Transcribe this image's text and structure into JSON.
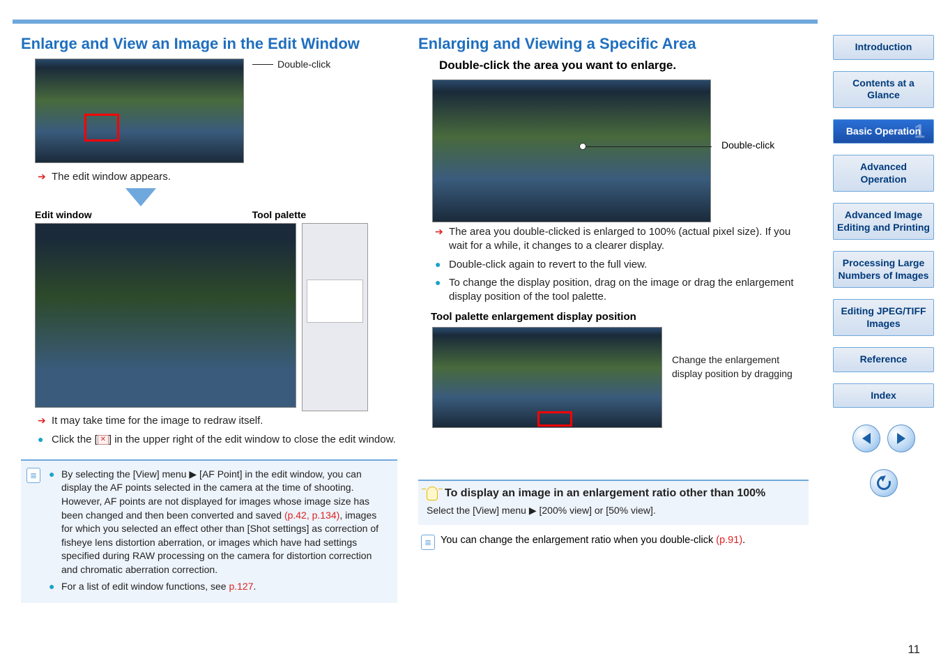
{
  "left": {
    "heading": "Enlarge and View an Image in the Edit Window",
    "doubleClick": "Double-click",
    "editAppears": "The edit window appears.",
    "editWindowLabel": "Edit window",
    "toolPaletteLabel": "Tool palette",
    "redrawNote": "It may take time for the image to redraw itself.",
    "closeNote_a": "Click the [",
    "closeNote_b": "] in the upper right of the edit window to close the edit window.",
    "info": {
      "p1_a": "By selecting the [View] menu ▶ [AF Point] in the edit window, you can display the AF points selected in the camera at the time of shooting. However, AF points are not displayed for images whose image size has been changed and then been converted and saved ",
      "p1_link": "(p.42, p.134)",
      "p1_b": ", images for which you selected an effect other than [Shot settings] as correction of fisheye lens distortion aberration, or images which have had settings specified during RAW processing on the camera for distortion correction and chromatic aberration correction.",
      "p2_a": "For a list of edit window functions, see ",
      "p2_link": "p.127",
      "p2_b": "."
    }
  },
  "right": {
    "heading": "Enlarging and Viewing a Specific Area",
    "sub": "Double-click the area you want to enlarge.",
    "doubleClick": "Double-click",
    "b1": "The area you double-clicked is enlarged to 100% (actual pixel size). If you wait for a while, it changes to a clearer display.",
    "b2": "Double-click again to revert to the full view.",
    "b3": "To change the display position, drag on the image or drag the enlargement display position of the tool palette.",
    "toolPalEnlLabel": "Tool palette enlargement display position",
    "dragNote": "Change the enlargement display position by dragging",
    "tip": {
      "title": "To display an image in an enlargement ratio other than 100%",
      "body": "Select the [View] menu ▶ [200% view] or [50% view]."
    },
    "note_a": "You can change the enlargement ratio when you double-click ",
    "note_link": "(p.91)",
    "note_b": "."
  },
  "nav": {
    "intro": "Introduction",
    "contents": "Contents at a Glance",
    "basic": "Basic Operation",
    "adv": "Advanced Operation",
    "advImg": "Advanced Image Editing and Printing",
    "proc": "Processing Large Numbers of Images",
    "edit": "Editing JPEG/TIFF Images",
    "ref": "Reference",
    "index": "Index"
  },
  "pageNumber": "11"
}
